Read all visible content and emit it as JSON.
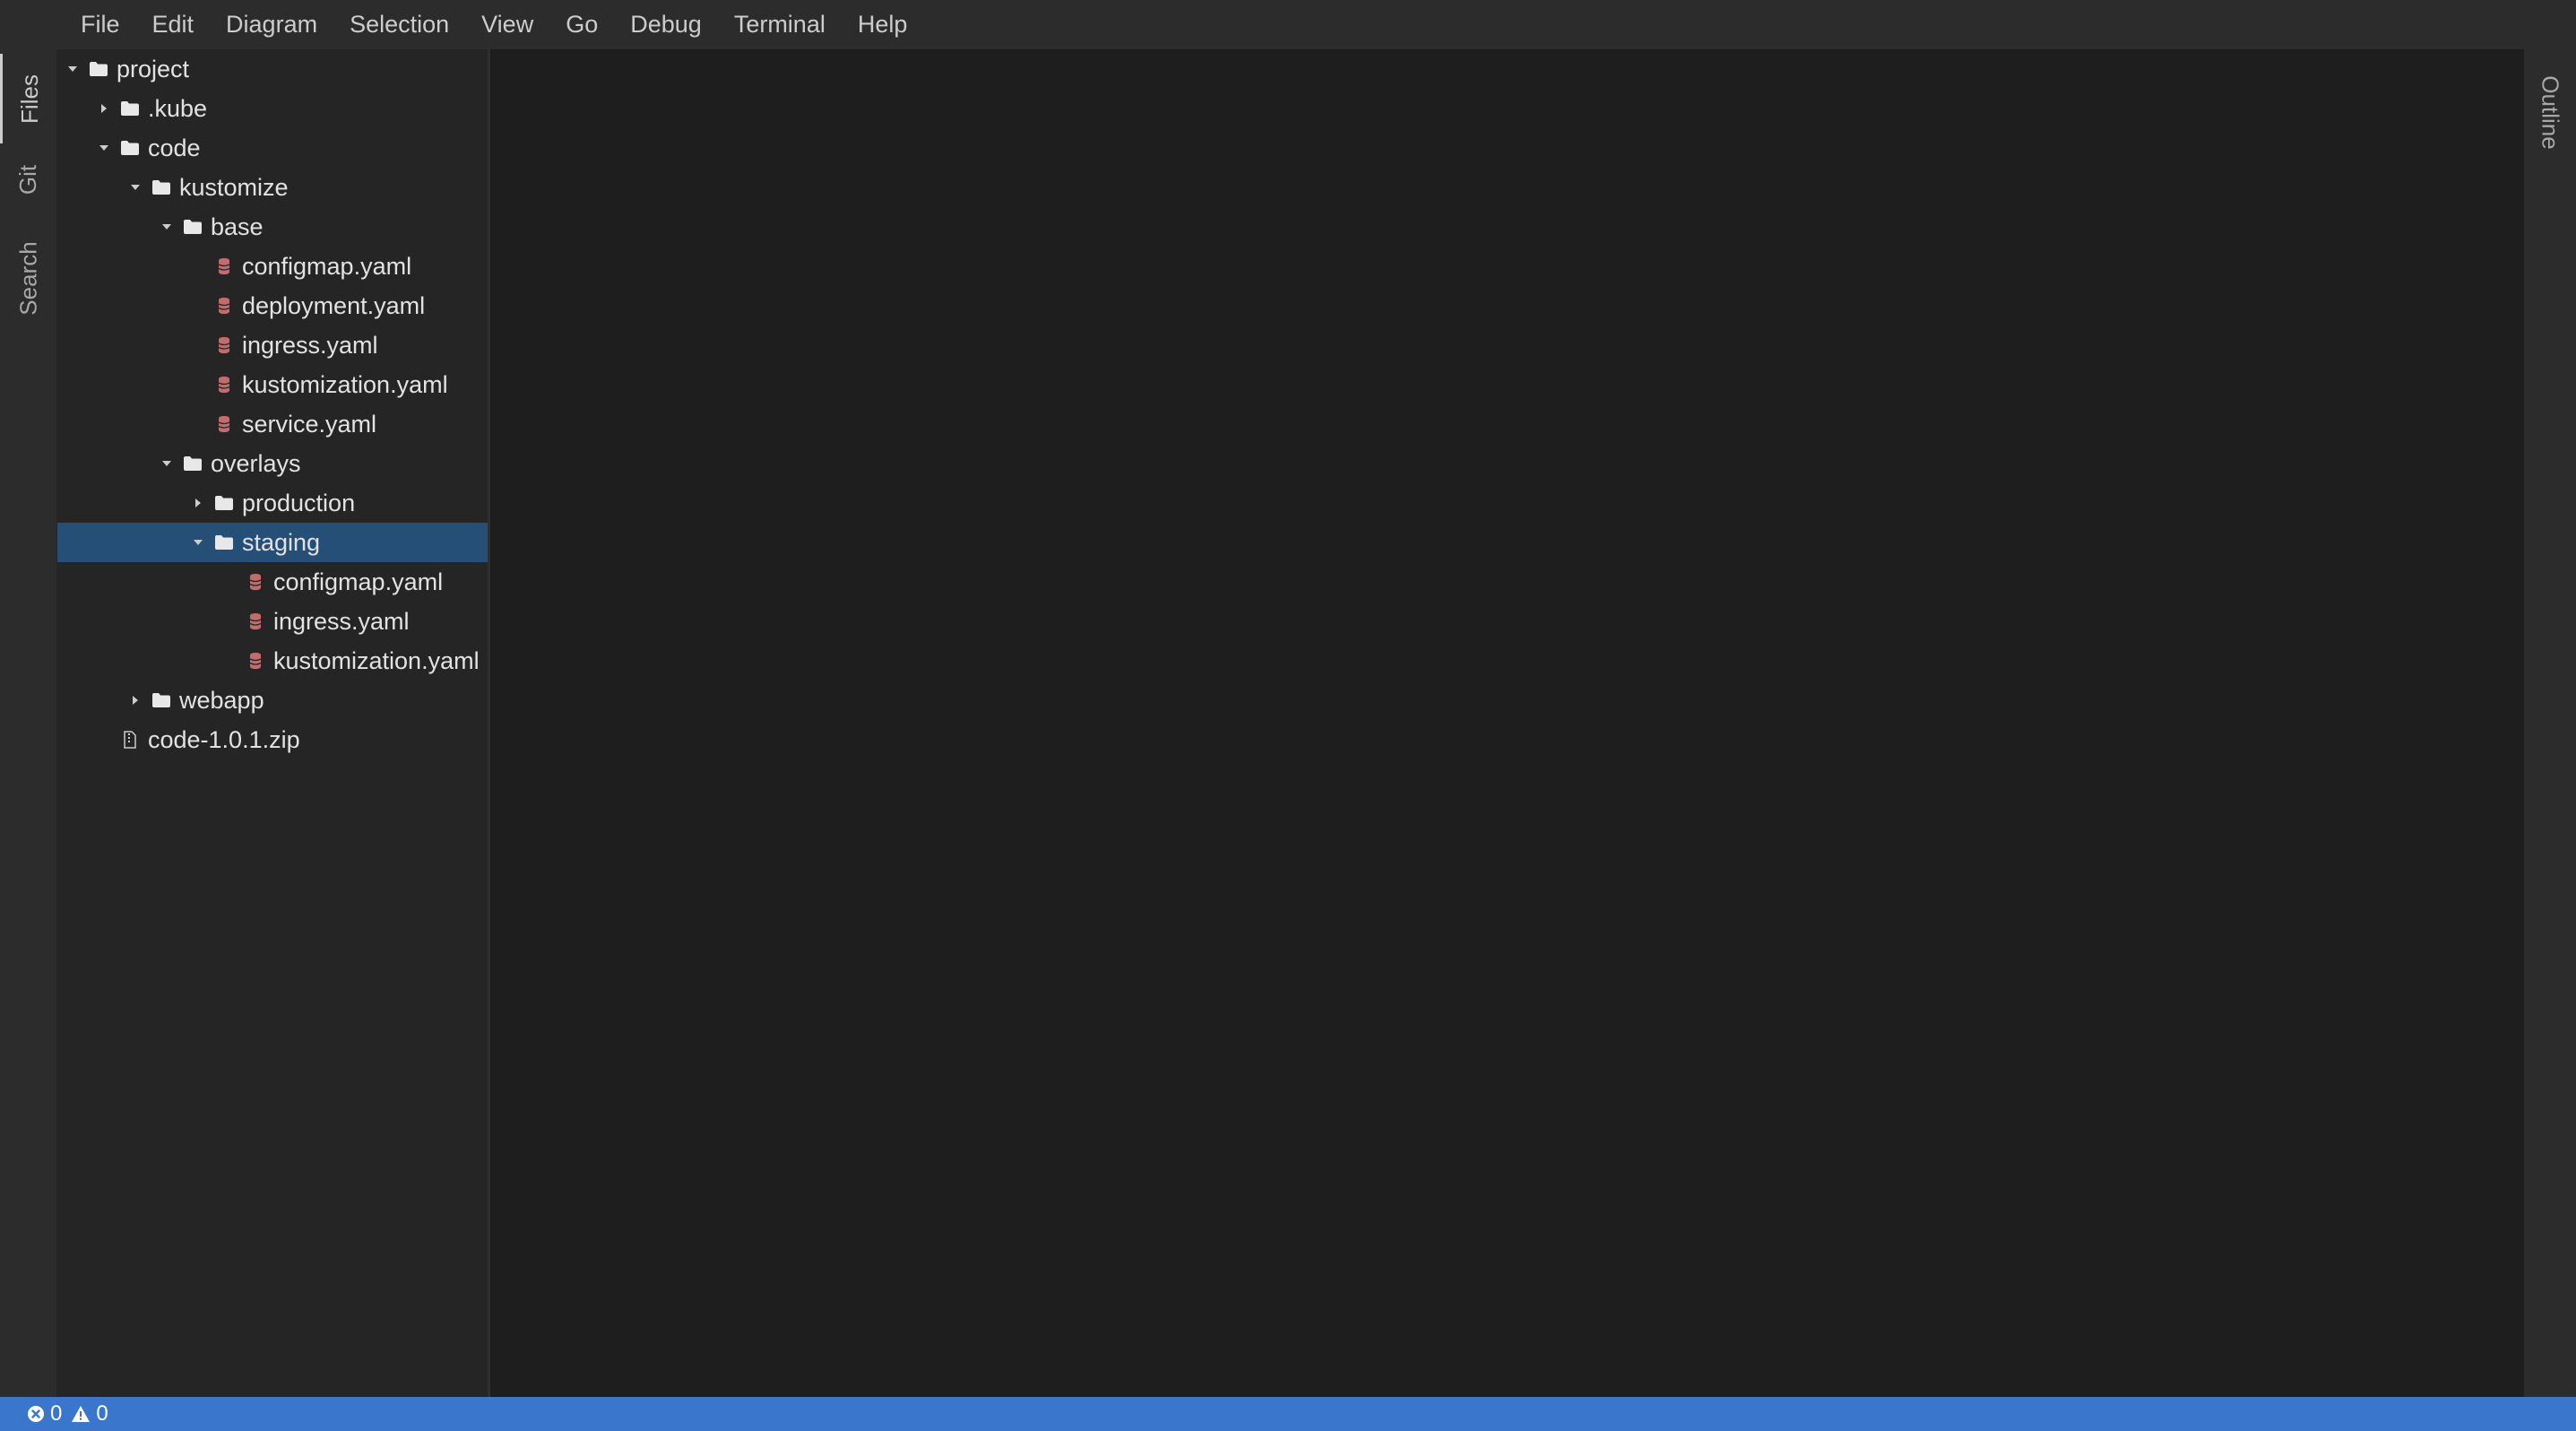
{
  "menu": [
    "File",
    "Edit",
    "Diagram",
    "Selection",
    "View",
    "Go",
    "Debug",
    "Terminal",
    "Help"
  ],
  "activity_left": [
    {
      "label": "Files",
      "active": true
    },
    {
      "label": "Git",
      "active": false
    },
    {
      "label": "Search",
      "active": false
    }
  ],
  "activity_right": {
    "label": "Outline"
  },
  "tree": [
    {
      "label": "project",
      "depth": 0,
      "kind": "folder",
      "expanded": true,
      "icon": "folder-icon"
    },
    {
      "label": ".kube",
      "depth": 1,
      "kind": "folder",
      "expanded": false,
      "icon": "folder-icon"
    },
    {
      "label": "code",
      "depth": 1,
      "kind": "folder",
      "expanded": true,
      "icon": "folder-icon"
    },
    {
      "label": "kustomize",
      "depth": 2,
      "kind": "folder",
      "expanded": true,
      "icon": "folder-icon"
    },
    {
      "label": "base",
      "depth": 3,
      "kind": "folder",
      "expanded": true,
      "icon": "folder-icon"
    },
    {
      "label": "configmap.yaml",
      "depth": 4,
      "kind": "file",
      "icon": "yaml-file-icon"
    },
    {
      "label": "deployment.yaml",
      "depth": 4,
      "kind": "file",
      "icon": "yaml-file-icon"
    },
    {
      "label": "ingress.yaml",
      "depth": 4,
      "kind": "file",
      "icon": "yaml-file-icon"
    },
    {
      "label": "kustomization.yaml",
      "depth": 4,
      "kind": "file",
      "icon": "yaml-file-icon"
    },
    {
      "label": "service.yaml",
      "depth": 4,
      "kind": "file",
      "icon": "yaml-file-icon"
    },
    {
      "label": "overlays",
      "depth": 3,
      "kind": "folder",
      "expanded": true,
      "icon": "folder-icon"
    },
    {
      "label": "production",
      "depth": 4,
      "kind": "folder",
      "expanded": false,
      "icon": "folder-icon"
    },
    {
      "label": "staging",
      "depth": 4,
      "kind": "folder",
      "expanded": true,
      "selected": true,
      "icon": "folder-icon"
    },
    {
      "label": "configmap.yaml",
      "depth": 5,
      "kind": "file",
      "icon": "yaml-file-icon"
    },
    {
      "label": "ingress.yaml",
      "depth": 5,
      "kind": "file",
      "icon": "yaml-file-icon"
    },
    {
      "label": "kustomization.yaml",
      "depth": 5,
      "kind": "file",
      "icon": "yaml-file-icon"
    },
    {
      "label": "webapp",
      "depth": 2,
      "kind": "folder",
      "expanded": false,
      "icon": "folder-icon"
    },
    {
      "label": "code-1.0.1.zip",
      "depth": 1,
      "kind": "file",
      "icon": "zip-file-icon"
    }
  ],
  "status": {
    "errors": "0",
    "warnings": "0",
    "error_icon": "error-icon",
    "warning_icon": "warning-icon"
  },
  "colors": {
    "selection": "#264f78",
    "statusbar": "#3a76cc",
    "yaml_icon": "#c56b6b",
    "background": "#1e1e1e"
  }
}
